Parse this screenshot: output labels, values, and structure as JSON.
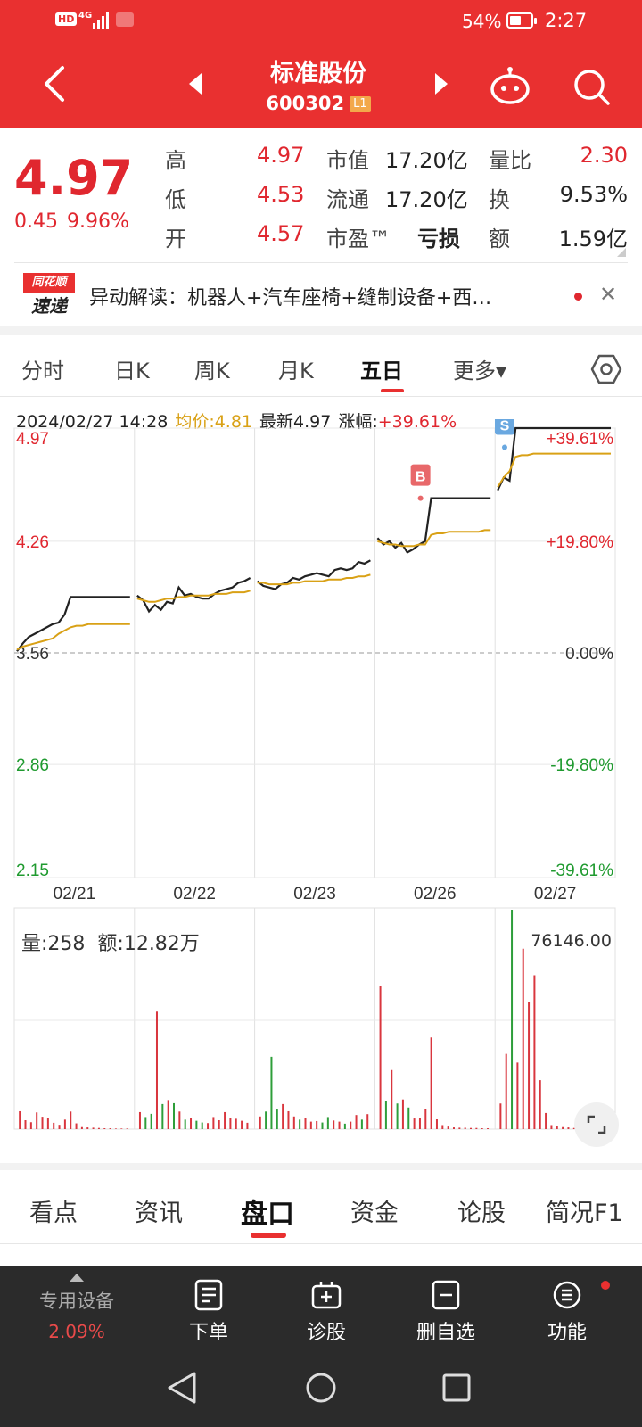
{
  "status": {
    "net": "4G",
    "battery_pct": "54%",
    "time": "2:27",
    "battery_level": 0.54
  },
  "header": {
    "title": "标准股份",
    "code": "600302",
    "level": "L1"
  },
  "quote": {
    "price": "4.97",
    "change": "0.45",
    "change_pct": "9.96%",
    "rows": [
      {
        "l1": "高",
        "v1": "4.97",
        "l2": "市值",
        "v2": "17.20亿",
        "l3": "量比",
        "v3": "2.30"
      },
      {
        "l1": "低",
        "v1": "4.53",
        "l2": "流通",
        "v2": "17.20亿",
        "l3": "换",
        "v3": "9.53%"
      },
      {
        "l1": "开",
        "v1": "4.57",
        "l2": "市盈™",
        "v2": "亏损",
        "l3": "额",
        "v3": "1.59亿"
      }
    ]
  },
  "news": {
    "logo_top": "同花顺",
    "logo_bottom": "速递",
    "text": "异动解读：机器人+汽车座椅+缝制设备+西…",
    "close": "✕"
  },
  "period_tabs": [
    "分时",
    "日K",
    "周K",
    "月K",
    "五日",
    "更多▾"
  ],
  "chart_info": {
    "time": "2024/02/27 14:28",
    "avg_label": "均价:4.81",
    "last_label": "最新4.97",
    "zf_label": "涨幅:",
    "zf_value": "+39.61%"
  },
  "vol_info": {
    "label": "量:258",
    "amount": "额:12.82万",
    "max": "76146.00"
  },
  "chart_data": {
    "type": "line",
    "title": "",
    "x_days": [
      "02/21",
      "02/22",
      "02/23",
      "02/26",
      "02/27"
    ],
    "y_ticks_left": [
      "4.97",
      "4.26",
      "3.56",
      "2.86",
      "2.15"
    ],
    "y_ticks_right": [
      "+39.61%",
      "+19.80%",
      "0.00%",
      "-19.80%",
      "-39.61%"
    ],
    "ylim": [
      2.15,
      4.97
    ],
    "baseline": 3.56,
    "markers": [
      {
        "label": "B",
        "day": "02/26",
        "price": 4.53
      },
      {
        "label": "S",
        "day": "02/27",
        "price": 4.85
      }
    ],
    "series": [
      {
        "name": "最新",
        "color": "#222222",
        "days": [
          [
            3.57,
            3.62,
            3.66,
            3.68,
            3.7,
            3.72,
            3.74,
            3.75,
            3.8,
            3.91,
            3.91,
            3.91,
            3.91,
            3.91,
            3.91,
            3.91,
            3.91,
            3.91,
            3.91,
            3.91
          ],
          [
            3.92,
            3.89,
            3.82,
            3.86,
            3.83,
            3.88,
            3.87,
            3.97,
            3.92,
            3.93,
            3.91,
            3.9,
            3.9,
            3.93,
            3.95,
            3.96,
            3.97,
            4.0,
            4.01,
            4.03
          ],
          [
            4.01,
            3.98,
            3.97,
            3.96,
            3.99,
            4.0,
            4.03,
            4.02,
            4.04,
            4.05,
            4.06,
            4.05,
            4.04,
            4.08,
            4.09,
            4.08,
            4.09,
            4.13,
            4.12,
            4.14
          ],
          [
            4.28,
            4.24,
            4.26,
            4.22,
            4.25,
            4.19,
            4.21,
            4.24,
            4.26,
            4.53,
            4.53,
            4.53,
            4.53,
            4.53,
            4.53,
            4.53,
            4.53,
            4.53,
            4.53,
            4.53
          ],
          [
            4.58,
            4.66,
            4.64,
            4.97,
            4.97,
            4.97,
            4.97,
            4.97,
            4.97,
            4.97,
            4.97,
            4.97,
            4.97,
            4.97,
            4.97,
            4.97,
            4.97,
            4.97,
            4.97,
            4.97
          ]
        ]
      },
      {
        "name": "均价",
        "color": "#d9a116",
        "days": [
          [
            3.58,
            3.6,
            3.61,
            3.62,
            3.63,
            3.64,
            3.65,
            3.68,
            3.7,
            3.72,
            3.73,
            3.73,
            3.74,
            3.74,
            3.74,
            3.74,
            3.74,
            3.74,
            3.74,
            3.74
          ],
          [
            3.9,
            3.89,
            3.88,
            3.88,
            3.89,
            3.9,
            3.9,
            3.91,
            3.91,
            3.92,
            3.92,
            3.92,
            3.92,
            3.93,
            3.93,
            3.93,
            3.94,
            3.94,
            3.94,
            3.95
          ],
          [
            4.0,
            4.0,
            3.99,
            3.99,
            3.99,
            3.99,
            4.0,
            4.0,
            4.01,
            4.01,
            4.01,
            4.01,
            4.02,
            4.02,
            4.02,
            4.03,
            4.03,
            4.04,
            4.04,
            4.05
          ],
          [
            4.26,
            4.25,
            4.24,
            4.24,
            4.23,
            4.23,
            4.23,
            4.24,
            4.24,
            4.3,
            4.31,
            4.31,
            4.32,
            4.32,
            4.32,
            4.32,
            4.32,
            4.32,
            4.33,
            4.33
          ],
          [
            4.6,
            4.66,
            4.7,
            4.79,
            4.8,
            4.8,
            4.81,
            4.81,
            4.81,
            4.81,
            4.81,
            4.81,
            4.81,
            4.81,
            4.81,
            4.81,
            4.81,
            4.81,
            4.81,
            4.81
          ]
        ]
      }
    ],
    "volume": {
      "max": 76146,
      "days": [
        [
          6200,
          3100,
          2400,
          5800,
          4300,
          3900,
          2200,
          1500,
          3300,
          6100,
          2000,
          700,
          600,
          500,
          400,
          300,
          300,
          200,
          200,
          200
        ],
        [
          5900,
          4200,
          5300,
          40800,
          8700,
          10100,
          9000,
          6100,
          3300,
          3800,
          2900,
          2300,
          2100,
          4200,
          3100,
          5900,
          4000,
          3600,
          2900,
          2200
        ],
        [
          4400,
          6100,
          25100,
          6800,
          8700,
          6200,
          4400,
          3300,
          3900,
          2600,
          2800,
          2300,
          4200,
          3000,
          2600,
          1900,
          2600,
          4900,
          3300,
          5200
        ],
        [
          49800,
          9700,
          20500,
          8900,
          10300,
          7500,
          3700,
          4000,
          6900,
          31800,
          3400,
          1400,
          900,
          600,
          500,
          500,
          400,
          400,
          300,
          300
        ],
        [
          8900,
          26100,
          76146,
          23100,
          62600,
          44100,
          53400,
          17000,
          5600,
          1400,
          1000,
          700,
          600,
          400,
          300,
          300,
          300,
          200,
          200,
          200
        ]
      ]
    }
  },
  "bottom_tabs": [
    "看点",
    "资讯",
    "盘口",
    "资金",
    "论股",
    "简况F1"
  ],
  "dock": {
    "left_name": "专用设备",
    "left_pct": "2.09%",
    "items": [
      "下单",
      "诊股",
      "删自选",
      "功能"
    ]
  },
  "colors": {
    "brand_red": "#e93030",
    "up": "#e0272f",
    "down": "#1f9a2f",
    "avg_line": "#d9a116"
  }
}
